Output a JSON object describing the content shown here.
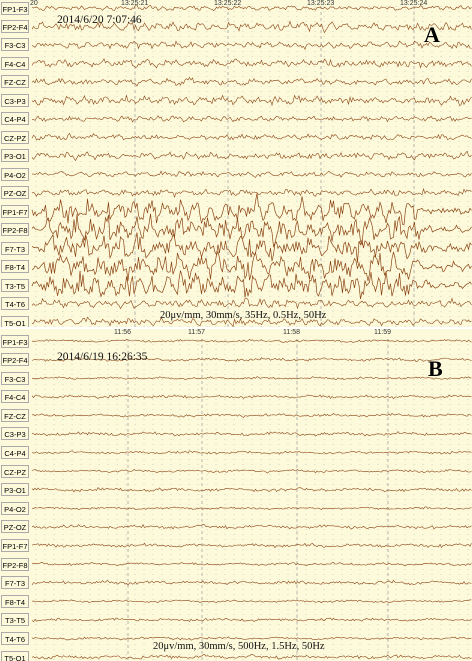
{
  "panels": [
    {
      "id": "A",
      "letter": "A",
      "timestamp": "2014/6/20 7:07:46",
      "settings": "20μv/mm, 30mm/s, 35Hz, 0.5Hz, 50Hz",
      "time_ticks": [
        "13:25:21",
        "13:25:22",
        "13:25:23",
        "13:25:24"
      ],
      "first_tick_partial": "20",
      "channels": [
        "FP1-F3",
        "FP2-F4",
        "F3-C3",
        "F4-C4",
        "FZ-CZ",
        "C3-P3",
        "C4-P4",
        "CZ-PZ",
        "P3-O1",
        "P4-O2",
        "PZ-OZ",
        "FP1-F7",
        "FP2-F8",
        "F7-T3",
        "F8-T4",
        "T3-T5",
        "T4-T6",
        "T5-O1"
      ],
      "high_amplitude_channels": [
        "FP1-F7",
        "FP2-F8",
        "F7-T3",
        "F8-T4",
        "T3-T5"
      ]
    },
    {
      "id": "B",
      "letter": "B",
      "timestamp": "2014/6/19 16:26:35",
      "settings": "20μv/mm, 30mm/s, 500Hz, 1.5Hz, 50Hz",
      "time_ticks": [
        "11:56",
        "11:57",
        "11:58",
        "11:59"
      ],
      "first_tick_partial": "",
      "channels": [
        "FP1-F3",
        "FP2-F4",
        "F3-C3",
        "F4-C4",
        "FZ-CZ",
        "C3-P3",
        "C4-P4",
        "CZ-PZ",
        "P3-O1",
        "P4-O2",
        "PZ-OZ",
        "FP1-F7",
        "FP2-F8",
        "F7-T3",
        "F8-T4",
        "T3-T5",
        "T4-T6",
        "T5-O1"
      ],
      "high_amplitude_channels": []
    }
  ],
  "colors": {
    "background": "#fdfadc",
    "trace": "#8b4513",
    "gridline": "#9a9a9a",
    "label_border": "#aaaaaa"
  }
}
